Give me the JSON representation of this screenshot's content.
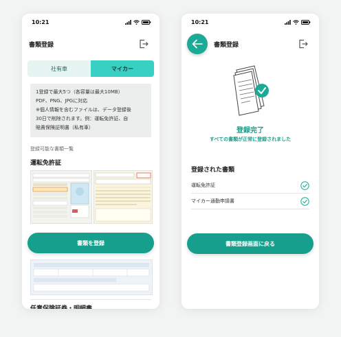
{
  "left_screen": {
    "status_time": "10:21",
    "header_title": "書類登録",
    "tabs": [
      {
        "label": "社有車",
        "active": false
      },
      {
        "label": "マイカー",
        "active": true
      }
    ],
    "info_lines": [
      "1登録で最大5つ（各容量は最大10MB）",
      "PDF、PNG、JPGに対応",
      "※個人情報を含むファイルは、データ登録後",
      "30日で削除されます。例：運転免許証、自",
      "賠責保険証明書（私有車）"
    ],
    "registrable_label": "登録可能な書類一覧",
    "section_title": "運転免許証",
    "register_button": "書類を登録",
    "next_section_title": "任意保険証券・明細書"
  },
  "right_screen": {
    "status_time": "10:21",
    "header_title": "書類登録",
    "complete_title": "登録完了",
    "complete_subtitle": "すべての書類が正常に登録されました",
    "registered_title": "登録された書類",
    "registered_items": [
      {
        "label": "運転免許証"
      },
      {
        "label": "マイカー通勤申請書"
      }
    ],
    "return_button": "書類登録画面に戻る"
  },
  "colors": {
    "accent": "#159f8c",
    "tab_active": "#38d0c2",
    "tab_inactive": "#e6f4f2"
  }
}
